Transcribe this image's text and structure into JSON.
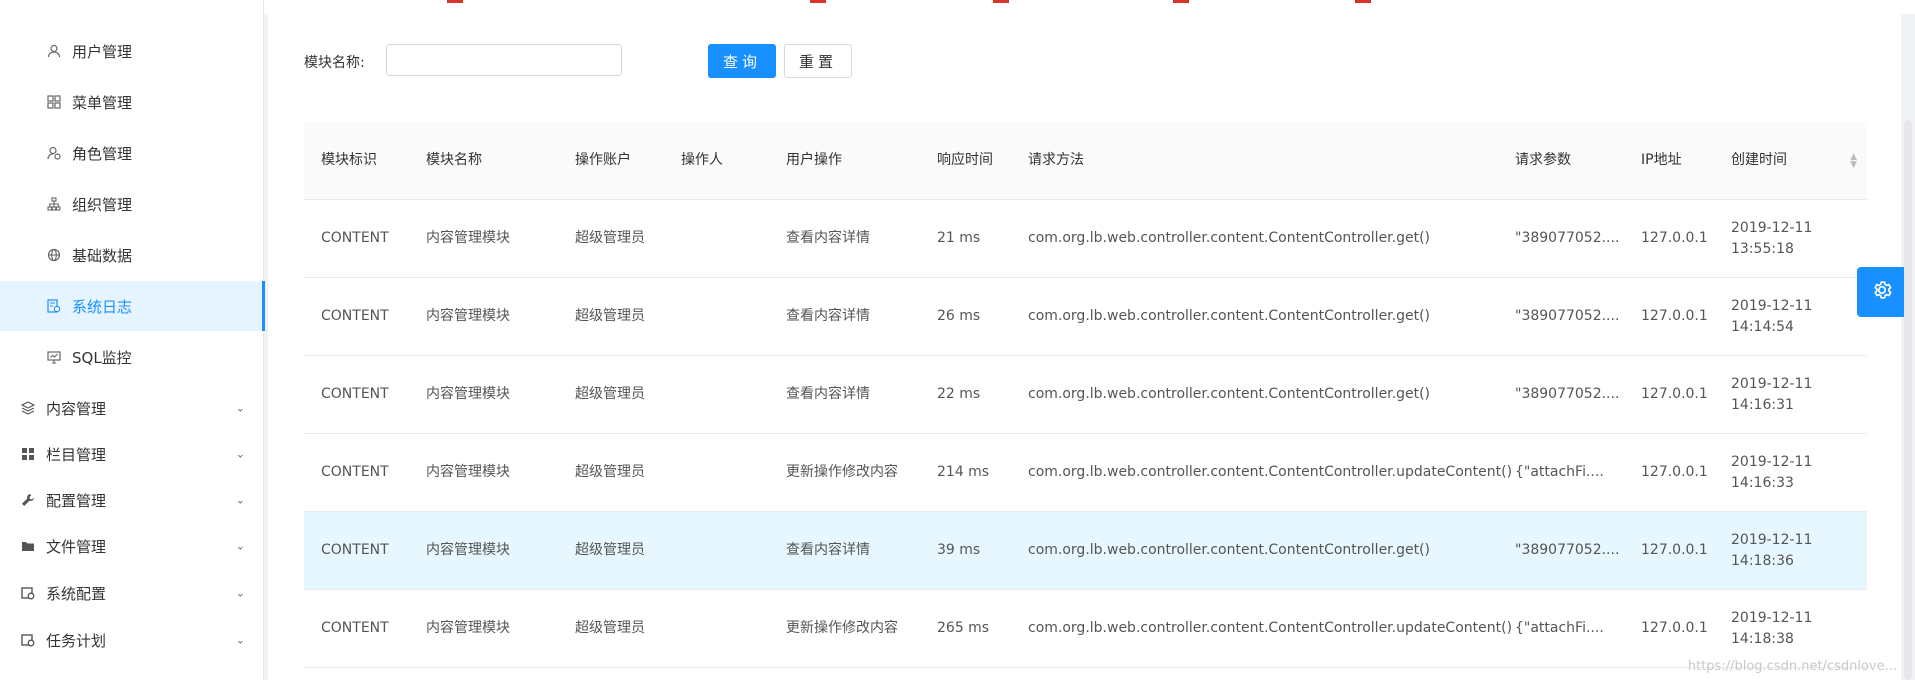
{
  "sidebar": {
    "items": [
      {
        "label": "用户管理",
        "icon": "user-icon",
        "active": false
      },
      {
        "label": "菜单管理",
        "icon": "grid-icon",
        "active": false
      },
      {
        "label": "角色管理",
        "icon": "role-icon",
        "active": false
      },
      {
        "label": "组织管理",
        "icon": "org-icon",
        "active": false
      },
      {
        "label": "基础数据",
        "icon": "globe-icon",
        "active": false
      },
      {
        "label": "系统日志",
        "icon": "log-icon",
        "active": true
      },
      {
        "label": "SQL监控",
        "icon": "monitor-icon",
        "active": false
      }
    ],
    "groups": [
      {
        "label": "内容管理",
        "icon": "layers-icon"
      },
      {
        "label": "栏目管理",
        "icon": "apps-icon"
      },
      {
        "label": "配置管理",
        "icon": "wrench-icon"
      },
      {
        "label": "文件管理",
        "icon": "folder-icon"
      },
      {
        "label": "系统配置",
        "icon": "config-icon"
      },
      {
        "label": "任务计划",
        "icon": "task-icon"
      }
    ]
  },
  "search": {
    "label": "模块名称:",
    "value": "",
    "placeholder": "",
    "query_label": "查询",
    "reset_label": "重置"
  },
  "table": {
    "columns": [
      "模块标识",
      "模块名称",
      "操作账户",
      "操作人",
      "用户操作",
      "响应时间",
      "请求方法",
      "请求参数",
      "IP地址",
      "创建时间"
    ],
    "rows": [
      [
        "CONTENT",
        "内容管理模块",
        "超级管理员",
        "",
        "查看内容详情",
        "21 ms",
        "com.org.lb.web.controller.content.ContentController.get()",
        "\"389077052....",
        "127.0.0.1",
        "2019-12-11 13:55:18"
      ],
      [
        "CONTENT",
        "内容管理模块",
        "超级管理员",
        "",
        "查看内容详情",
        "26 ms",
        "com.org.lb.web.controller.content.ContentController.get()",
        "\"389077052....",
        "127.0.0.1",
        "2019-12-11 14:14:54"
      ],
      [
        "CONTENT",
        "内容管理模块",
        "超级管理员",
        "",
        "查看内容详情",
        "22 ms",
        "com.org.lb.web.controller.content.ContentController.get()",
        "\"389077052....",
        "127.0.0.1",
        "2019-12-11 14:16:31"
      ],
      [
        "CONTENT",
        "内容管理模块",
        "超级管理员",
        "",
        "更新操作修改内容",
        "214 ms",
        "com.org.lb.web.controller.content.ContentController.updateContent()",
        "{\"attachFi....",
        "127.0.0.1",
        "2019-12-11 14:16:33"
      ],
      [
        "CONTENT",
        "内容管理模块",
        "超级管理员",
        "",
        "查看内容详情",
        "39 ms",
        "com.org.lb.web.controller.content.ContentController.get()",
        "\"389077052....",
        "127.0.0.1",
        "2019-12-11 14:18:36"
      ],
      [
        "CONTENT",
        "内容管理模块",
        "超级管理员",
        "",
        "更新操作修改内容",
        "265 ms",
        "com.org.lb.web.controller.content.ContentController.updateContent()",
        "{\"attachFi....",
        "127.0.0.1",
        "2019-12-11 14:18:38"
      ]
    ],
    "highlighted_row": 4
  },
  "watermark": "https://blog.csdn.net/csdnlove...",
  "colors": {
    "accent": "#1890ff",
    "active_bg": "#e6f4ff",
    "highlight_row": "#e6f7ff"
  }
}
